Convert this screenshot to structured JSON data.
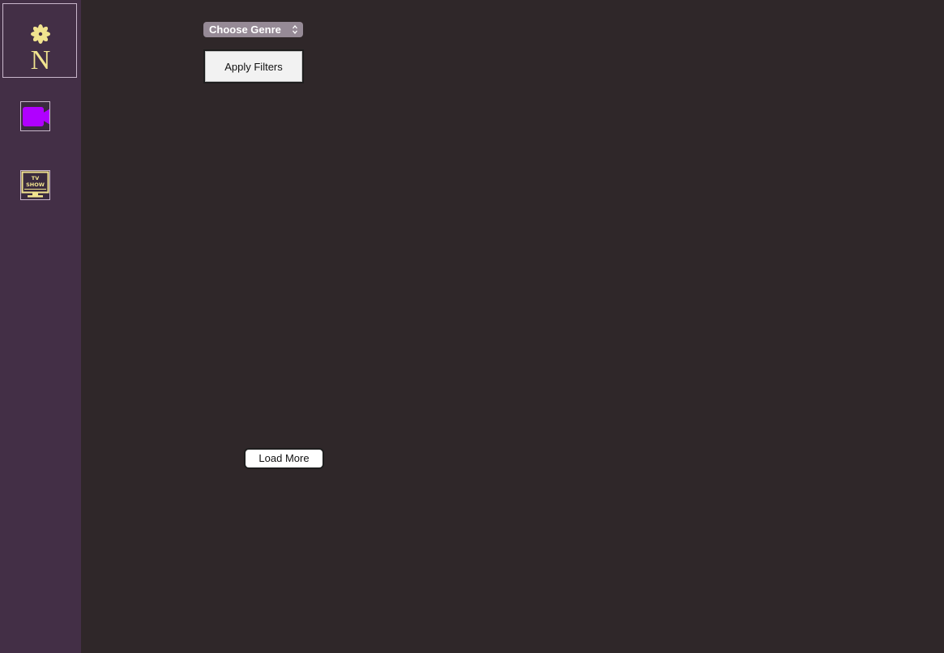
{
  "sidebar": {
    "logo": {
      "letter": "N",
      "icon": "flower-logo-icon",
      "color": "#f1e38f"
    },
    "items": [
      {
        "name": "movies",
        "icon": "video-camera-icon",
        "color": "#b000ff"
      },
      {
        "name": "tv-shows",
        "icon": "tv-show-icon",
        "label": "TV SHOW",
        "color": "#f1e38f"
      }
    ]
  },
  "filters": {
    "genre_placeholder": "Choose Genre",
    "apply_label": "Apply Filters"
  },
  "pagination": {
    "load_more_label": "Load More"
  },
  "colors": {
    "sidebar_bg": "#432f46",
    "main_bg": "#2f2729",
    "accent": "#f1e38f",
    "movie_icon": "#b000ff"
  }
}
